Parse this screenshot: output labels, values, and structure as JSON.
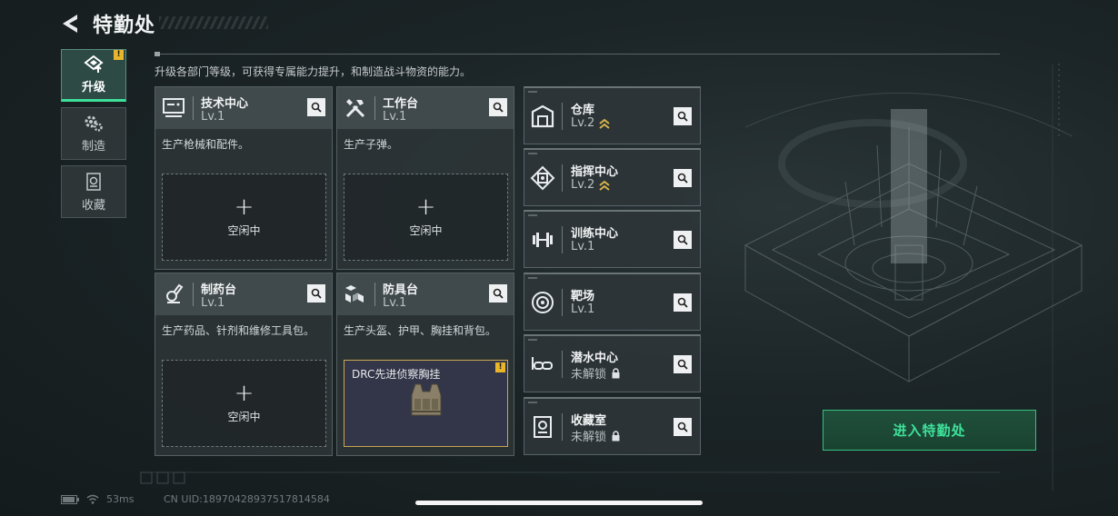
{
  "header": {
    "title": "特勤处"
  },
  "nav": {
    "items": [
      {
        "label": "升级",
        "icon": "upgrade-icon",
        "active": true,
        "badge": "!"
      },
      {
        "label": "制造",
        "icon": "gears-icon",
        "active": false
      },
      {
        "label": "收藏",
        "icon": "collection-icon",
        "active": false
      }
    ]
  },
  "description": "升级各部门等级，可获得专属能力提升，和制造战斗物资的能力。",
  "departments": [
    {
      "name": "技术中心",
      "level": "Lv.1",
      "icon": "tech-center-icon",
      "desc": "生产枪械和配件。",
      "slot": {
        "label": "空闲中"
      }
    },
    {
      "name": "工作台",
      "level": "Lv.1",
      "icon": "workbench-icon",
      "desc": "生产子弹。",
      "slot": {
        "label": "空闲中"
      }
    },
    {
      "name": "制药台",
      "level": "Lv.1",
      "icon": "pharmacy-icon",
      "desc": "生产药品、针剂和维修工具包。",
      "slot": {
        "label": "空闲中"
      }
    },
    {
      "name": "防具台",
      "level": "Lv.1",
      "icon": "armor-bench-icon",
      "desc": "生产头盔、护甲、胸挂和背包。",
      "slot": {
        "item": "DRC先进侦察胸挂",
        "badge": "!"
      }
    }
  ],
  "buildings": [
    {
      "name": "仓库",
      "level": "Lv.2",
      "icon": "warehouse-icon",
      "upgradable": true
    },
    {
      "name": "指挥中心",
      "level": "Lv.2",
      "icon": "command-center-icon",
      "upgradable": true
    },
    {
      "name": "训练中心",
      "level": "Lv.1",
      "icon": "training-center-icon",
      "upgradable": false
    },
    {
      "name": "靶场",
      "level": "Lv.1",
      "icon": "shooting-range-icon",
      "upgradable": false
    },
    {
      "name": "潜水中心",
      "level": "未解锁",
      "icon": "diving-center-icon",
      "locked": true
    },
    {
      "name": "收藏室",
      "level": "未解锁",
      "icon": "collection-room-icon",
      "locked": true
    }
  ],
  "enter_button": "进入特勤处",
  "status": {
    "ping": "53ms",
    "uid": "CN UID:18970428937517814584"
  },
  "colors": {
    "accent": "#3ee09a",
    "badge": "#e8b52a",
    "upgrade": "#d8b44a"
  }
}
